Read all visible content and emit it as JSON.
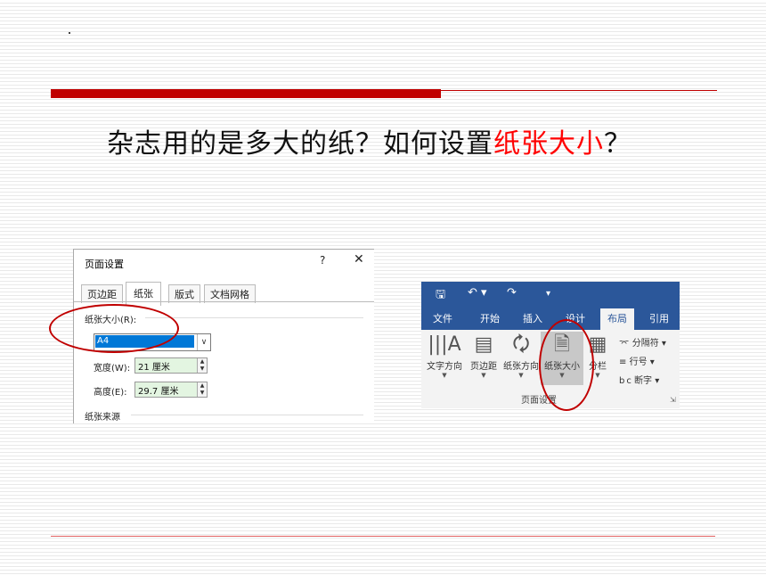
{
  "slide": {
    "dot": ".",
    "question_part1": "杂志用的是多大的纸？如何设置",
    "question_highlight": "纸张大小",
    "question_part2": "？",
    "colors": {
      "accent_red": "#c00000",
      "highlight_text": "#ff0000",
      "ribbon_blue": "#2b579a"
    }
  },
  "dialog": {
    "title": "页面设置",
    "help": "?",
    "close": "✕",
    "tabs": [
      "页边距",
      "纸张",
      "版式",
      "文档网格"
    ],
    "active_tab": "纸张",
    "paper_size_label": "纸张大小(R):",
    "paper_size_value": "A4",
    "width_label": "宽度(W):",
    "width_value": "21 厘米",
    "height_label": "高度(E):",
    "height_value": "29.7 厘米",
    "paper_source_label": "纸张来源"
  },
  "ribbon": {
    "qat": {
      "save_icon": "save-icon",
      "undo": "↶ ▾",
      "redo": "↷",
      "more": "▾"
    },
    "tabs": [
      "文件",
      "开始",
      "插入",
      "设计",
      "布局",
      "引用"
    ],
    "active_tab": "布局",
    "buttons": [
      {
        "label": "文字方向",
        "icon": "text-direction-icon"
      },
      {
        "label": "页边距",
        "icon": "margins-icon"
      },
      {
        "label": "纸张方向",
        "icon": "orientation-icon"
      },
      {
        "label": "纸张大小",
        "icon": "paper-size-icon"
      },
      {
        "label": "分栏",
        "icon": "columns-icon"
      }
    ],
    "small_buttons": [
      "分隔符 ▾",
      "行号 ▾",
      "断字 ▾"
    ],
    "group_label": "页面设置"
  }
}
